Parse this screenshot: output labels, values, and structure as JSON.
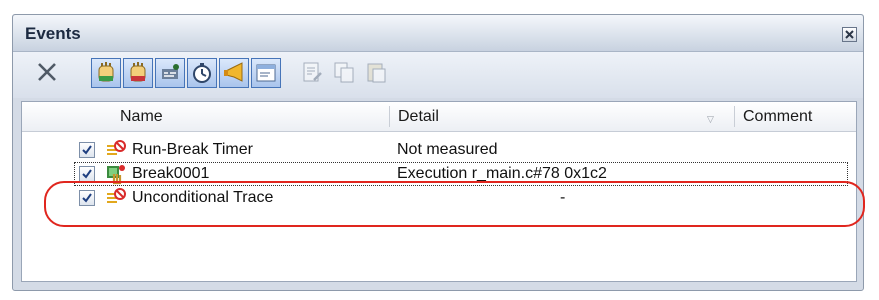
{
  "panel": {
    "title": "Events"
  },
  "toolbar": {
    "buttons": [
      {
        "icon": "delete-icon",
        "state": "enabled"
      },
      {
        "icon": "hardware-break-icon",
        "state": "toggled"
      },
      {
        "icon": "software-break-icon",
        "state": "toggled"
      },
      {
        "icon": "trace-icon",
        "state": "toggled"
      },
      {
        "icon": "timer-icon",
        "state": "toggled"
      },
      {
        "icon": "action-event-icon",
        "state": "toggled"
      },
      {
        "icon": "output-icon",
        "state": "toggled"
      },
      {
        "icon": "edit-condition-icon",
        "state": "disabled"
      },
      {
        "icon": "copy-event-icon",
        "state": "disabled"
      },
      {
        "icon": "paste-event-icon",
        "state": "disabled"
      }
    ]
  },
  "table": {
    "columns": {
      "name": "Name",
      "detail": "Detail",
      "comment": "Comment"
    },
    "rows": [
      {
        "checked": true,
        "icon": "run-break-timer-icon",
        "name": "Run-Break Timer",
        "detail": "Not measured",
        "comment": ""
      },
      {
        "checked": true,
        "icon": "breakpoint-icon",
        "name": "Break0001",
        "detail": "Execution r_main.c#78 0x1c2",
        "comment": "",
        "selected": true
      },
      {
        "checked": true,
        "icon": "unconditional-trace-icon",
        "name": "Unconditional Trace",
        "detail": "-",
        "comment": ""
      }
    ]
  },
  "colors": {
    "highlight": "#e0261e",
    "toggled_button": "#a9c4ec",
    "panel_bg": "#d4dbe6"
  }
}
